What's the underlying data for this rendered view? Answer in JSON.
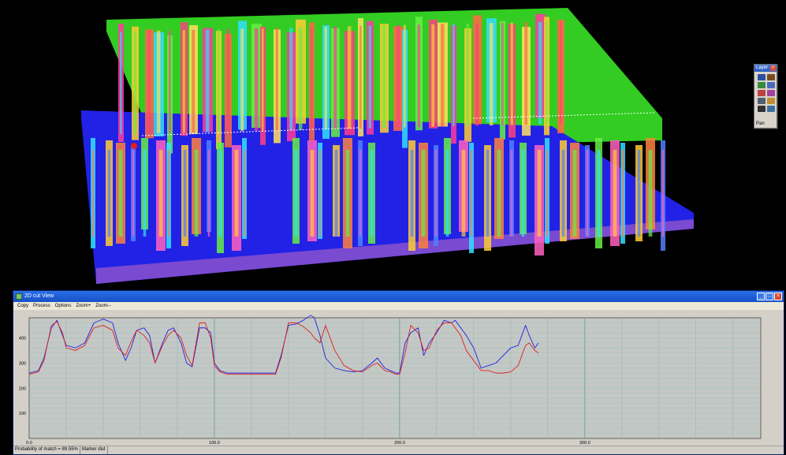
{
  "palette": {
    "title": "Layer",
    "mode": "Pan",
    "tools": [
      "move-tool-icon",
      "anchor-tool-icon",
      "rotate-tool-icon",
      "zoom-tool-icon",
      "person-tool-icon",
      "layers-tool-icon",
      "cut-tool-icon",
      "brightness-tool-icon",
      "camera-tool-icon",
      "grid-tool-icon"
    ]
  },
  "window": {
    "title": "2D cut View",
    "menu": [
      "Copy",
      "Process",
      "Options",
      "Zoom+",
      "Zoom--"
    ]
  },
  "status": {
    "probability": "Probability of match = 89.55%",
    "marker": "Marker dist"
  },
  "colors": {
    "series_blue": "#2020e0",
    "series_red": "#e02020",
    "grid_h": "#9cc2c8",
    "grid_v": "#8fb3b6",
    "plot_bg": "#c4c8c4"
  },
  "chart_data": {
    "type": "line",
    "title": "",
    "xlabel": "",
    "ylabel": "",
    "xlim": [
      0,
      395
    ],
    "ylim": [
      0,
      480
    ],
    "xticks": [
      0,
      100,
      200,
      300
    ],
    "xticklabels": [
      "0.0",
      "100.0",
      "200.0",
      "300.0"
    ],
    "yticks": [
      100,
      200,
      300,
      400
    ],
    "yticklabels": [
      "100",
      "200",
      "300",
      "400"
    ],
    "grid": true,
    "series": [
      {
        "color": "#2020e0",
        "x": [
          0,
          5,
          8,
          12,
          15,
          18,
          20,
          25,
          30,
          35,
          40,
          45,
          48,
          52,
          55,
          58,
          62,
          65,
          68,
          72,
          75,
          78,
          82,
          85,
          88,
          92,
          95,
          98,
          100,
          103,
          107,
          112,
          120,
          125,
          130,
          133,
          136,
          140,
          144,
          148,
          152,
          154,
          157,
          160,
          165,
          170,
          175,
          180,
          185,
          188,
          192,
          195,
          198,
          200,
          203,
          206,
          210,
          213,
          216,
          220,
          224,
          228,
          230,
          233,
          236,
          240,
          244,
          248,
          252,
          256,
          260,
          264,
          268,
          270,
          273,
          275
        ],
        "values": [
          260,
          270,
          320,
          440,
          470,
          410,
          370,
          360,
          380,
          460,
          475,
          460,
          380,
          310,
          360,
          430,
          440,
          410,
          300,
          380,
          430,
          440,
          380,
          300,
          285,
          440,
          440,
          420,
          300,
          270,
          260,
          260,
          260,
          260,
          260,
          260,
          330,
          450,
          455,
          470,
          490,
          480,
          410,
          320,
          280,
          270,
          265,
          270,
          300,
          320,
          280,
          270,
          260,
          260,
          380,
          420,
          440,
          330,
          380,
          420,
          470,
          460,
          470,
          440,
          410,
          360,
          280,
          290,
          300,
          330,
          360,
          370,
          450,
          410,
          360,
          380
        ]
      },
      {
        "color": "#e02020",
        "x": [
          0,
          5,
          8,
          12,
          15,
          18,
          20,
          25,
          30,
          35,
          40,
          45,
          48,
          52,
          55,
          58,
          62,
          65,
          68,
          72,
          75,
          78,
          82,
          85,
          88,
          92,
          95,
          98,
          100,
          103,
          107,
          112,
          120,
          125,
          130,
          133,
          136,
          140,
          144,
          148,
          152,
          154,
          157,
          160,
          165,
          170,
          175,
          180,
          185,
          188,
          192,
          195,
          198,
          200,
          203,
          206,
          210,
          213,
          216,
          220,
          224,
          228,
          230,
          233,
          236,
          240,
          244,
          248,
          252,
          256,
          260,
          264,
          268,
          270,
          273,
          275
        ],
        "values": [
          255,
          265,
          310,
          450,
          465,
          420,
          360,
          350,
          370,
          440,
          450,
          430,
          360,
          330,
          385,
          430,
          410,
          380,
          300,
          370,
          410,
          430,
          400,
          330,
          290,
          460,
          460,
          400,
          290,
          265,
          255,
          255,
          255,
          255,
          255,
          255,
          320,
          460,
          460,
          445,
          420,
          400,
          380,
          450,
          350,
          290,
          270,
          265,
          290,
          300,
          270,
          265,
          255,
          255,
          340,
          450,
          420,
          350,
          360,
          430,
          460,
          460,
          440,
          410,
          350,
          310,
          270,
          270,
          260,
          260,
          265,
          290,
          370,
          380,
          350,
          340
        ]
      }
    ]
  }
}
